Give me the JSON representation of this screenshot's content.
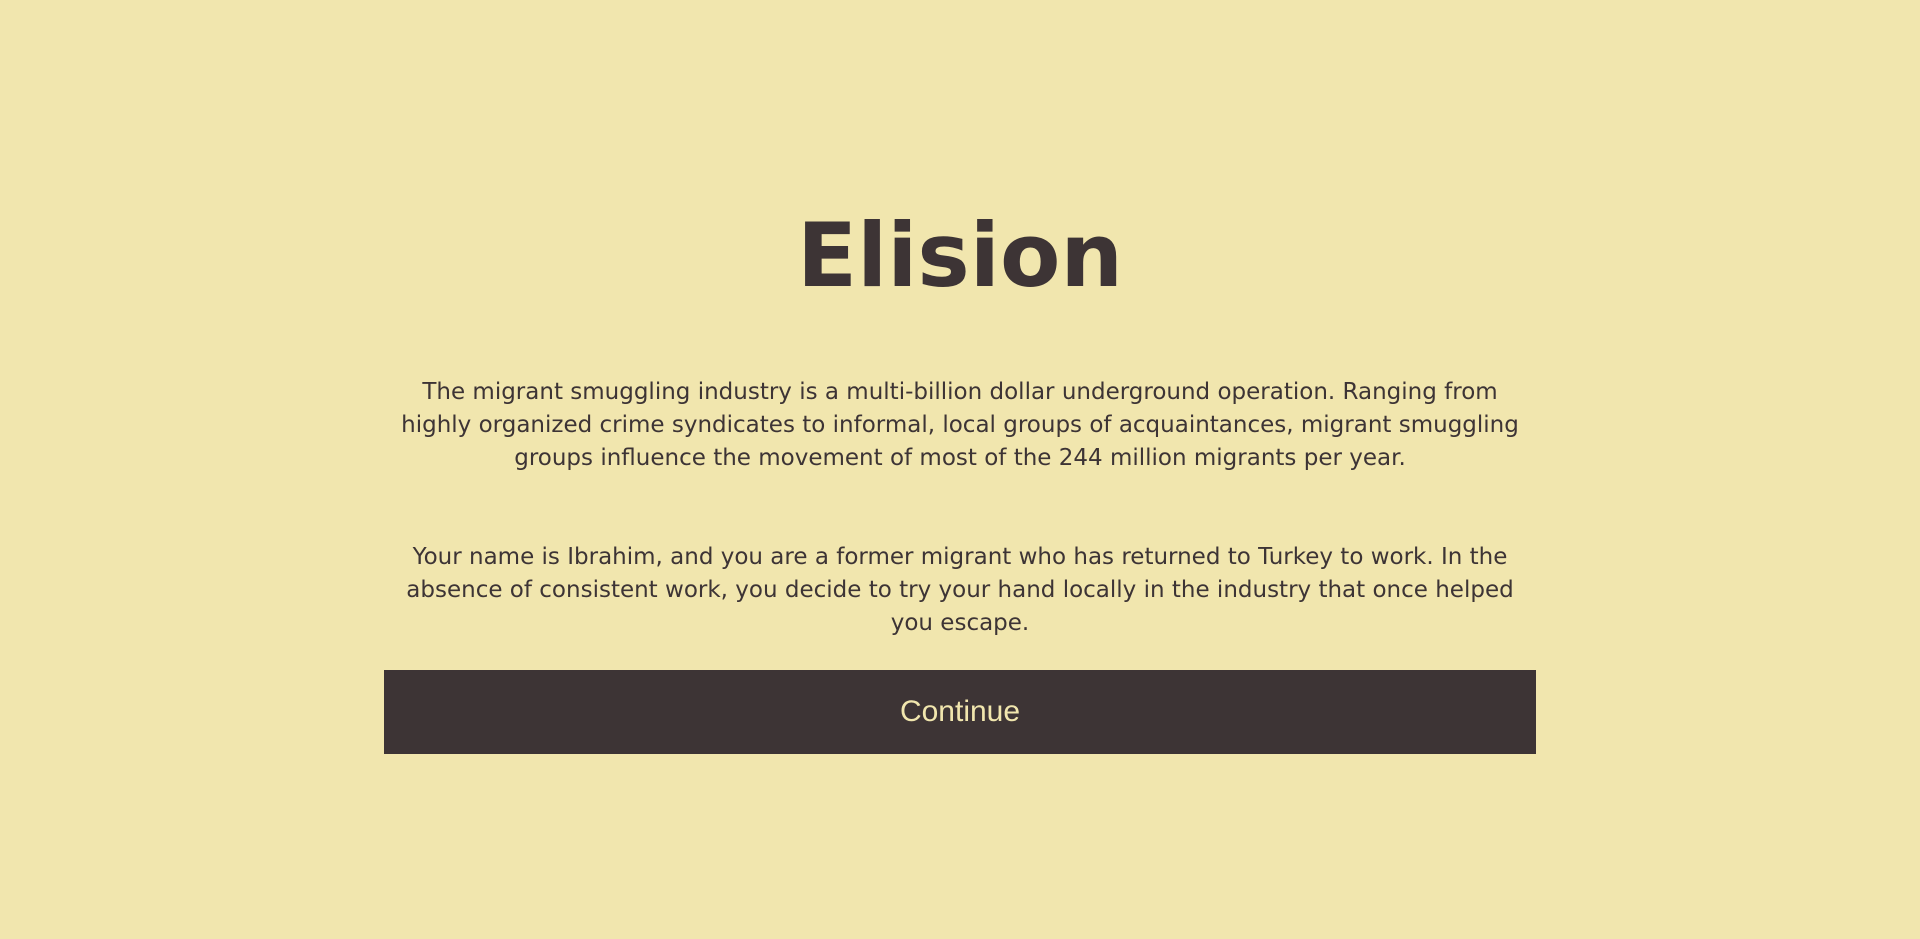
{
  "game": {
    "title": "Elision",
    "paragraphs": [
      "The migrant smuggling industry is a multi-billion dollar underground operation. Ranging from highly organized crime syndicates to informal, local groups of acquaintances, migrant smuggling groups influence the movement of most of the 244 million migrants per year.",
      "Your name is Ibrahim, and you are a former migrant who has returned to Turkey to work. In the absence of consistent work, you decide to try your hand locally in the industry that once helped you escape."
    ],
    "continue_label": "Continue"
  },
  "colors": {
    "background": "#f1e6ae",
    "text": "#3d3435",
    "button_background": "#3d3435",
    "button_text": "#f1e6ae"
  }
}
